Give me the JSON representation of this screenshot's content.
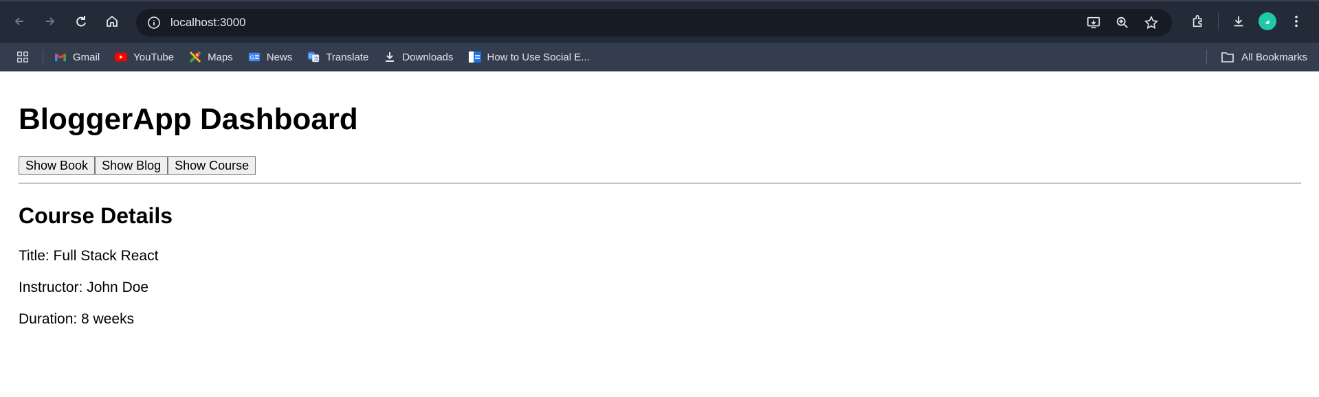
{
  "browser": {
    "url": "localhost:3000",
    "bookmarks": [
      {
        "label": "Gmail",
        "icon": "gmail-icon"
      },
      {
        "label": "YouTube",
        "icon": "youtube-icon"
      },
      {
        "label": "Maps",
        "icon": "maps-icon"
      },
      {
        "label": "News",
        "icon": "news-icon"
      },
      {
        "label": "Translate",
        "icon": "translate-icon"
      },
      {
        "label": "Downloads",
        "icon": "download-icon"
      },
      {
        "label": "How to Use Social E...",
        "icon": "page-icon"
      }
    ],
    "all_bookmarks_label": "All Bookmarks"
  },
  "page": {
    "title": "BloggerApp Dashboard",
    "buttons": {
      "book": "Show Book",
      "blog": "Show Blog",
      "course": "Show Course"
    },
    "section_title": "Course Details",
    "details": {
      "title": "Title: Full Stack React",
      "instructor": "Instructor: John Doe",
      "duration": "Duration: 8 weeks"
    }
  },
  "colors": {
    "toolbar": "#232a38",
    "bookmarks_bar": "#343d4e",
    "omnibox": "#161b26"
  }
}
